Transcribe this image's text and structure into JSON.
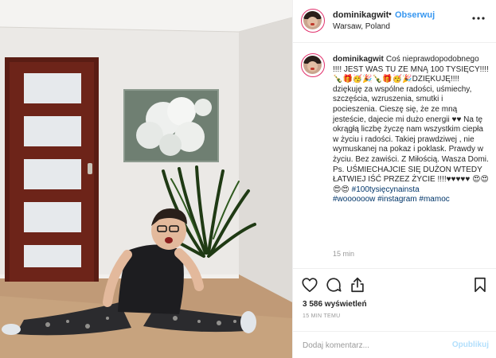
{
  "post": {
    "username": "dominikagwit",
    "dot": "•",
    "follow_label": "Obserwuj",
    "location": "Warsaw, Poland"
  },
  "caption": {
    "text_main": "Coś nieprawdopodobnego !!!! JEST WAS TU ZE MNĄ 100 TYSIĘCY!!!! 🍾🎁🥳🎉🍾🎁🥳🎉DZIĘKUJĘ!!!! dziękuję za wspólne radości, uśmiechy, szczęścia, wzruszenia, smutki i pocieszenia. Cieszę się, że ze mną jesteście, dajecie mi dużo energii ♥♥ Na tę okrągłą liczbę życzę nam wszystkim ciepła w życiu i radości. Takiej prawdziwej , nie wymuskanej na pokaz i poklask. Prawdy w życiu. Bez zawiści. Z Miłością. Wasza Domi.\nPs. UŚMIECHAJCIE SIĘ DUŻON WTEDY ŁATWIEJ IŚĆ PRZEZ ŻYCIE !!!!♥♥♥♥♥ 😍😍😍😍",
    "hashtag_1": "#100tysięcynainsta",
    "hashtag_2": "#woooooow",
    "hashtag_3": "#instagram",
    "hashtag_4": "#mamoc",
    "time_ago": "15 min"
  },
  "actions": {
    "views": "3 586 wyświetleń",
    "timestamp": "15 MIN TEMU"
  },
  "comment": {
    "placeholder": "Dodaj komentarz...",
    "publish_label": "Opublikuj"
  },
  "icons": {
    "like": "heart-icon",
    "comment": "comment-bubble-icon",
    "share": "share-plane-icon",
    "save": "bookmark-icon",
    "more": "more-horizontal-icon"
  },
  "colors": {
    "follow": "#3897f0",
    "hashtag": "#003569",
    "publish_disabled": "#b2dffc",
    "avatar_ring": "#e1306c"
  }
}
